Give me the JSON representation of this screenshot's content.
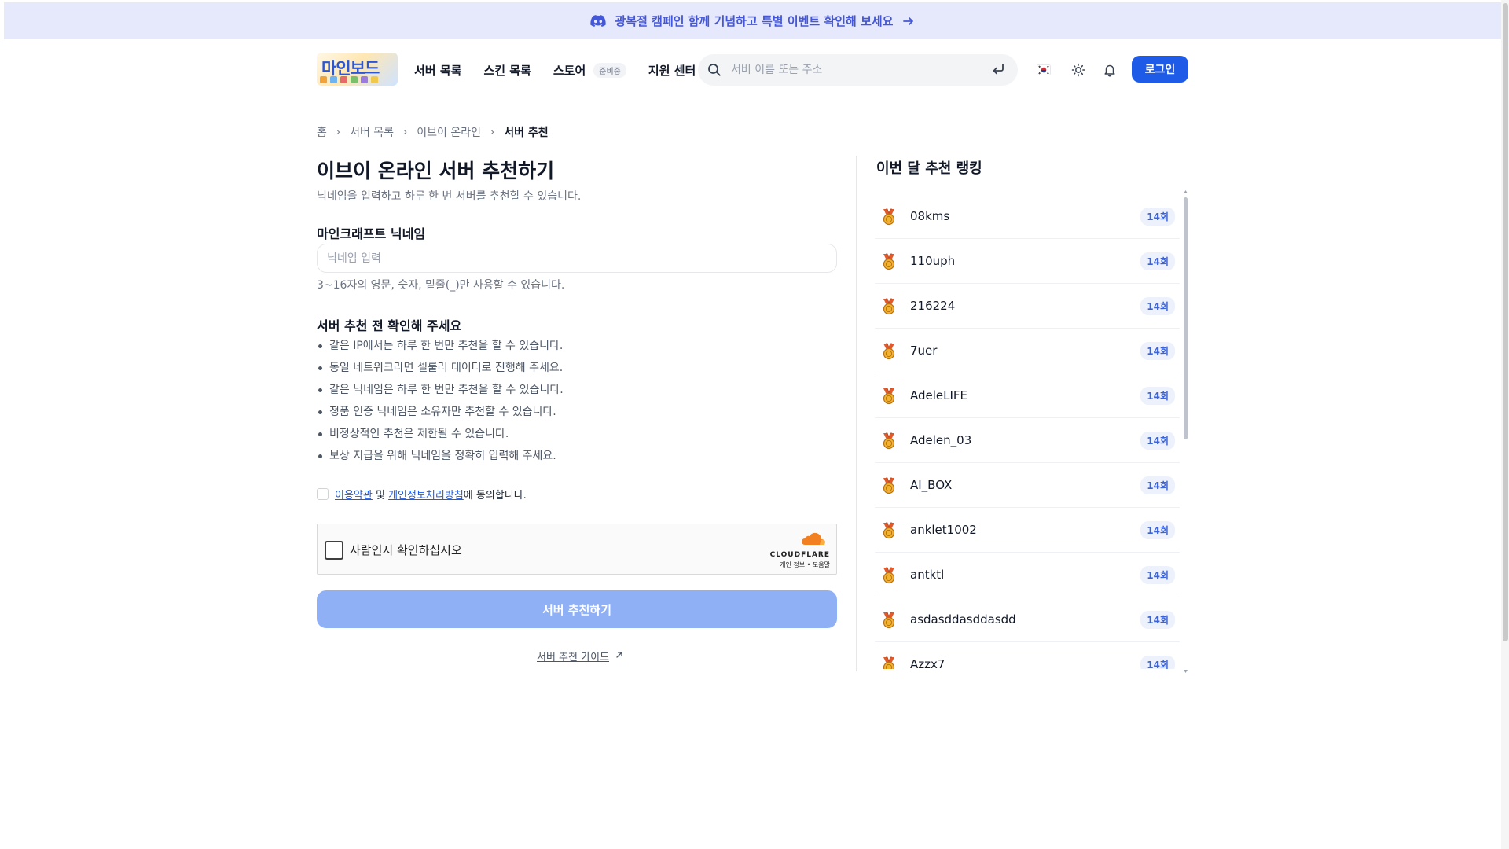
{
  "banner": {
    "text": "광복절 캠페인 함께 기념하고 특별 이벤트 확인해 보세요",
    "icon": "discord-icon",
    "arrow_icon": "arrow-right-icon",
    "color": "#4457d8",
    "background": "#e6e9fb"
  },
  "header": {
    "logo_text": "마인보드",
    "nav": [
      {
        "label": "서버 목록"
      },
      {
        "label": "스킨 목록"
      },
      {
        "label": "스토어",
        "badge": "준비중"
      },
      {
        "label": "지원 센터"
      }
    ],
    "search": {
      "placeholder": "서버 이름 또는 주소",
      "value": ""
    },
    "icons": [
      "korea-flag-icon",
      "sun-icon",
      "bell-icon"
    ],
    "login_label": "로그인",
    "accent": "#1e5be6"
  },
  "breadcrumb": [
    "홈",
    "서버 목록",
    "이브이 온라인",
    "서버 추천"
  ],
  "form": {
    "title": "이브이 온라인 서버 추천하기",
    "description": "닉네임을 입력하고 하루 한 번 서버를 추천할 수 있습니다.",
    "nickname_label": "마인크래프트 닉네임",
    "nickname_placeholder": "닉네임 입력",
    "nickname_value": "",
    "nickname_help": "3~16자의 영문, 숫자, 밑줄(_)만 사용할 수 있습니다.",
    "notice_title": "서버 추천 전 확인해 주세요",
    "notices": [
      "같은 IP에서는 하루 한 번만 추천을 할 수 있습니다.",
      "동일 네트워크라면 셀룰러 데이터로 진행해 주세요.",
      "같은 닉네임은 하루 한 번만 추천을 할 수 있습니다.",
      "정품 인증 닉네임은 소유자만 추천할 수 있습니다.",
      "비정상적인 추천은 제한될 수 있습니다.",
      "보상 지급을 위해 닉네임을 정확히 입력해 주세요."
    ],
    "agree": {
      "terms_link": "이용약관",
      "and": "및",
      "privacy_link": "개인정보처리방침",
      "suffix": "에 동의합니다.",
      "checked": false
    },
    "captcha": {
      "label": "사람인지 확인하십시오",
      "brand": "CLOUDFLARE",
      "privacy": "개인 정보",
      "dot": "•",
      "help": "도움말",
      "checked": false
    },
    "submit_label": "서버 추천하기",
    "submit_color": "#8fb0f4",
    "guide_label": "서버 추천 가이드"
  },
  "ranking": {
    "title": "이번 달 추천 랭킹",
    "items": [
      {
        "name": "08kms",
        "count": "14회"
      },
      {
        "name": "110uph",
        "count": "14회"
      },
      {
        "name": "216224",
        "count": "14회"
      },
      {
        "name": "7uer",
        "count": "14회"
      },
      {
        "name": "AdeleLIFE",
        "count": "14회"
      },
      {
        "name": "Adelen_03",
        "count": "14회"
      },
      {
        "name": "AI_BOX",
        "count": "14회"
      },
      {
        "name": "anklet1002",
        "count": "14회"
      },
      {
        "name": "antktl",
        "count": "14회"
      },
      {
        "name": "asdasddasddasdd",
        "count": "14회"
      },
      {
        "name": "Azzx7",
        "count": "14회"
      }
    ],
    "medal_icon": "medal-icon",
    "count_color": "#3b63d6"
  }
}
